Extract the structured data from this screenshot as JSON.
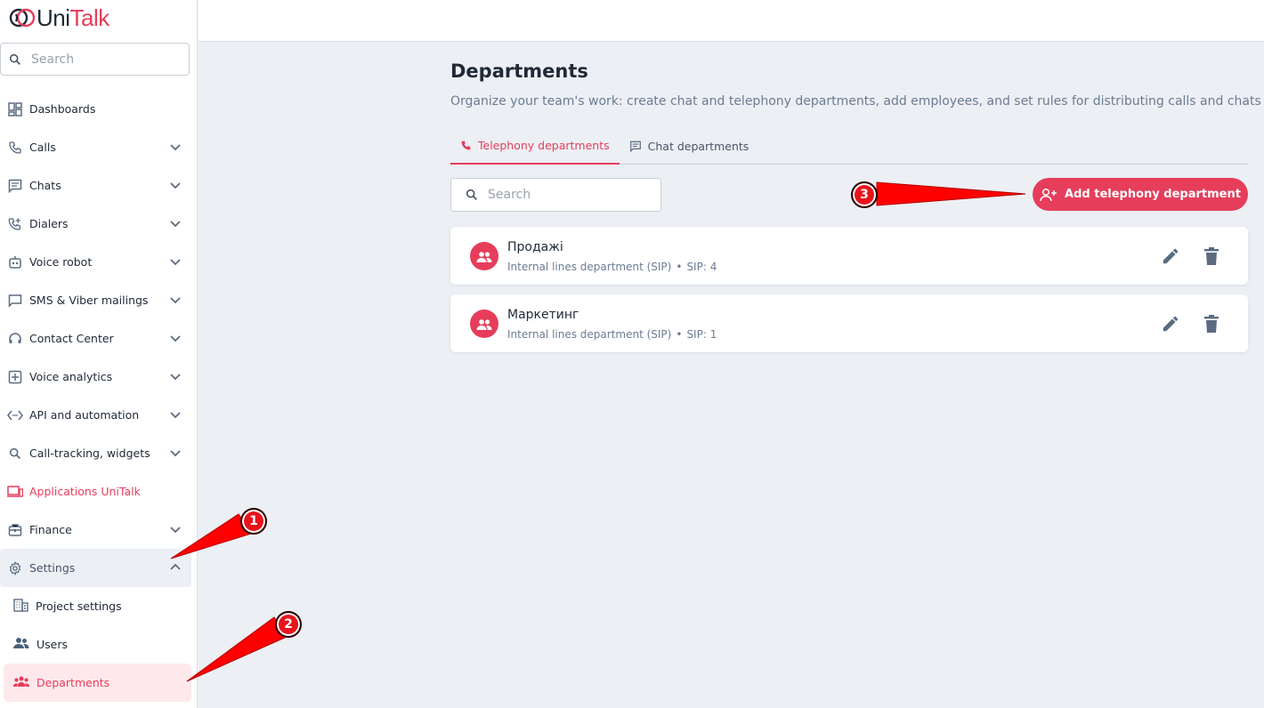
{
  "brand": {
    "uni": "Uni",
    "talk": "Talk"
  },
  "sidebar": {
    "search_placeholder": "Search",
    "items": [
      {
        "label": "Dashboards",
        "icon": "dashboard-icon"
      },
      {
        "label": "Calls",
        "icon": "phone-icon"
      },
      {
        "label": "Chats",
        "icon": "chat-icon"
      },
      {
        "label": "Dialers",
        "icon": "dialer-icon"
      },
      {
        "label": "Voice robot",
        "icon": "robot-icon"
      },
      {
        "label": "SMS & Viber mailings",
        "icon": "message-icon"
      },
      {
        "label": "Contact Center",
        "icon": "headset-icon"
      },
      {
        "label": "Voice analytics",
        "icon": "analytics-icon"
      },
      {
        "label": "API and automation",
        "icon": "api-icon"
      },
      {
        "label": "Call-tracking, widgets",
        "icon": "search-icon"
      },
      {
        "label": "Applications UniTalk",
        "icon": "devices-icon"
      },
      {
        "label": "Finance",
        "icon": "wallet-icon"
      },
      {
        "label": "Settings",
        "icon": "gear-icon"
      }
    ],
    "sub_items": [
      {
        "label": "Project settings",
        "icon": "building-icon"
      },
      {
        "label": "Users",
        "icon": "users-icon"
      },
      {
        "label": "Departments",
        "icon": "groups-icon"
      }
    ]
  },
  "main": {
    "title": "Departments",
    "description": "Organize your team's work: create chat and telephony departments, add employees, and set rules for distributing calls and chats",
    "tabs": [
      {
        "label": "Telephony departments"
      },
      {
        "label": "Chat departments"
      }
    ],
    "search_placeholder": "Search",
    "add_button": "Add telephony department",
    "departments": [
      {
        "name": "Продажі",
        "type": "Internal lines department (SIP)",
        "sip": "SIP: 4"
      },
      {
        "name": "Маркетинг",
        "type": "Internal lines department (SIP)",
        "sip": "SIP: 1"
      }
    ]
  },
  "annotations": [
    {
      "label": "1"
    },
    {
      "label": "2"
    },
    {
      "label": "3"
    }
  ],
  "colors": {
    "accent": "#e63d5b",
    "annotation": "#e8141c",
    "background": "#eceff4"
  }
}
